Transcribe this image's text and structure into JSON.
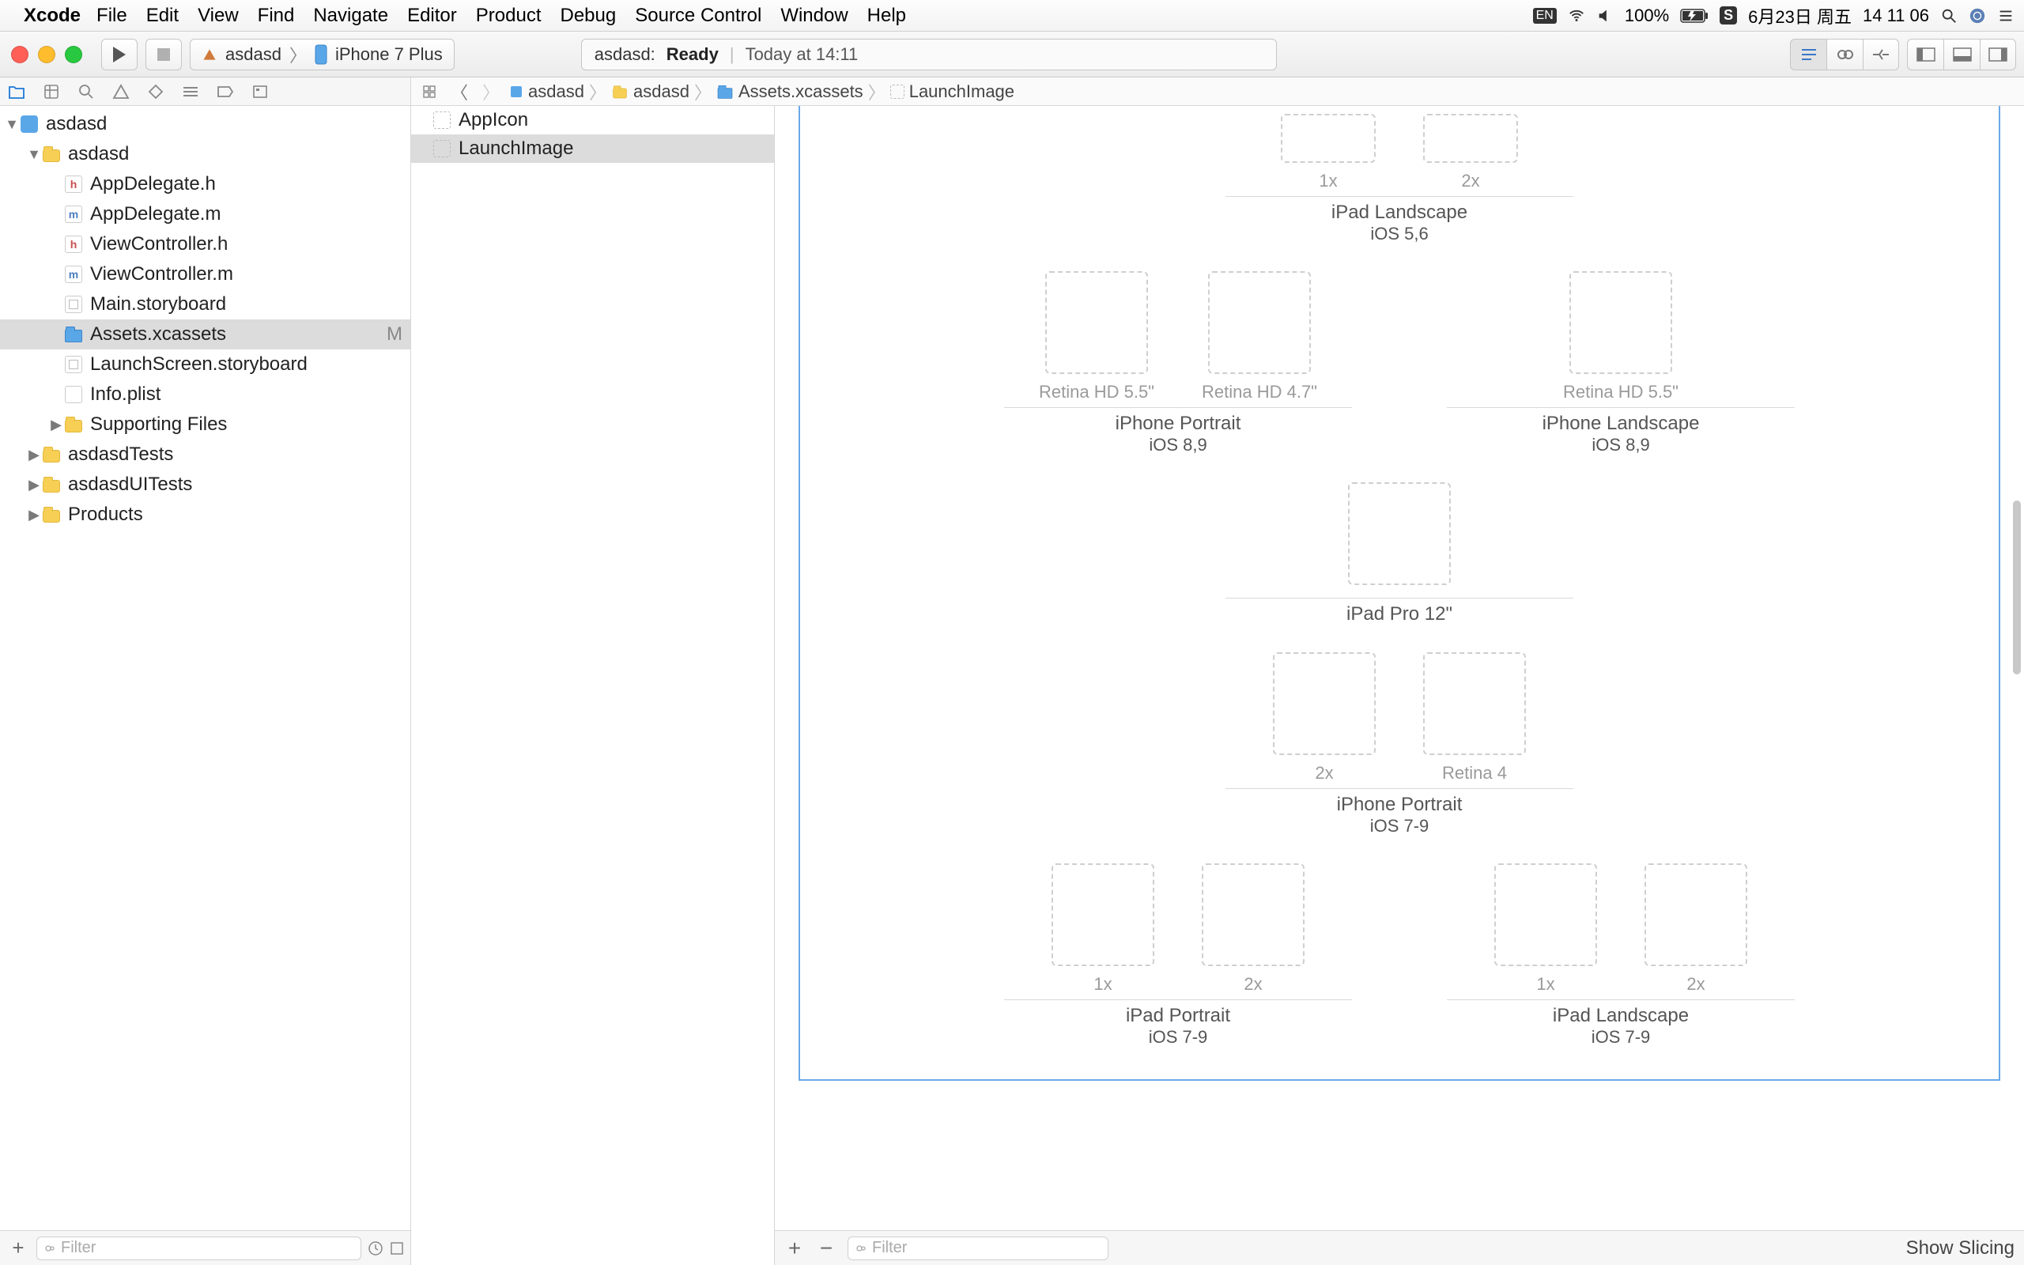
{
  "menubar": {
    "app": "Xcode",
    "items": [
      "File",
      "Edit",
      "View",
      "Find",
      "Navigate",
      "Editor",
      "Product",
      "Debug",
      "Source Control",
      "Window",
      "Help"
    ],
    "status": {
      "input": "EN",
      "battery_pct": "100%",
      "date": "6月23日 周五",
      "time": "14 11 06"
    }
  },
  "toolbar": {
    "scheme_target": "asdasd",
    "scheme_device": "iPhone 7 Plus",
    "activity_name": "asdasd:",
    "activity_status": "Ready",
    "activity_time": "Today at 14:11"
  },
  "navigator": {
    "filter_placeholder": "Filter",
    "tree": {
      "project": "asdasd",
      "group": "asdasd",
      "files": [
        {
          "name": "AppDelegate.h",
          "type": "h"
        },
        {
          "name": "AppDelegate.m",
          "type": "m"
        },
        {
          "name": "ViewController.h",
          "type": "h"
        },
        {
          "name": "ViewController.m",
          "type": "m"
        },
        {
          "name": "Main.storyboard",
          "type": "sb"
        },
        {
          "name": "Assets.xcassets",
          "type": "assets",
          "selected": true,
          "status": "M"
        },
        {
          "name": "LaunchScreen.storyboard",
          "type": "sb"
        },
        {
          "name": "Info.plist",
          "type": "plist"
        }
      ],
      "supporting": "Supporting Files",
      "targets": [
        "asdasdTests",
        "asdasdUITests",
        "Products"
      ]
    }
  },
  "jumpbar": {
    "crumbs": [
      "asdasd",
      "asdasd",
      "Assets.xcassets",
      "LaunchImage"
    ]
  },
  "asset_list": {
    "items": [
      {
        "name": "AppIcon",
        "selected": false
      },
      {
        "name": "LaunchImage",
        "selected": true
      }
    ],
    "filter_placeholder": "Filter"
  },
  "canvas": {
    "groups": [
      {
        "slots": [
          {
            "label": "1x",
            "small": true
          },
          {
            "label": "2x",
            "small": true
          }
        ],
        "title": "iPad Landscape",
        "sub": "iOS 5,6"
      },
      {
        "slots": [
          {
            "label": "Retina HD 5.5\""
          },
          {
            "label": "Retina HD 4.7\""
          }
        ],
        "title": "iPhone Portrait",
        "sub": "iOS 8,9",
        "right_slots": [
          {
            "label": "Retina HD 5.5\""
          }
        ],
        "right_title": "iPhone Landscape",
        "right_sub": "iOS 8,9"
      },
      {
        "slots": [
          {
            "label": ""
          }
        ],
        "title": "iPad Pro 12\"",
        "sub": ""
      },
      {
        "slots": [
          {
            "label": "2x"
          },
          {
            "label": "Retina 4"
          }
        ],
        "title": "iPhone Portrait",
        "sub": "iOS 7-9"
      },
      {
        "slots": [
          {
            "label": "1x"
          },
          {
            "label": "2x"
          }
        ],
        "title": "iPad Portrait",
        "sub": "iOS 7-9",
        "right_slots": [
          {
            "label": "1x"
          },
          {
            "label": "2x"
          }
        ],
        "right_title": "iPad Landscape",
        "right_sub": "iOS 7-9"
      }
    ],
    "show_slicing": "Show Slicing"
  }
}
